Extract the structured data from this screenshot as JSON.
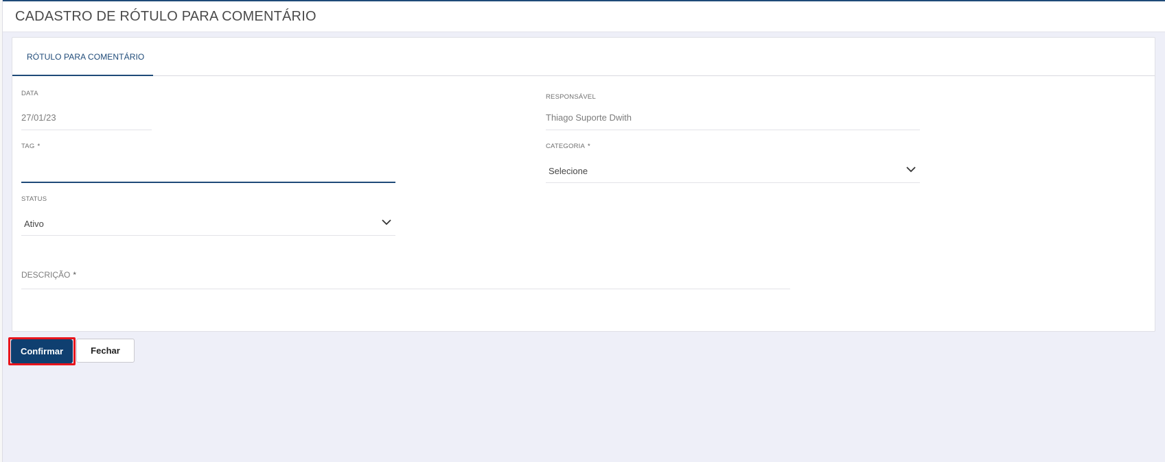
{
  "page": {
    "title": "CADASTRO DE RÓTULO PARA COMENTÁRIO"
  },
  "tabs": [
    {
      "label": "RÓTULO PARA COMENTÁRIO",
      "active": true
    }
  ],
  "form": {
    "data": {
      "label": "DATA",
      "value": "27/01/23"
    },
    "responsavel": {
      "label": "RESPONSÁVEL",
      "value": "Thiago Suporte Dwith"
    },
    "tag": {
      "label": "TAG",
      "required": "*",
      "value": ""
    },
    "categoria": {
      "label": "CATEGORIA",
      "required": "*",
      "selected": "Selecione"
    },
    "status": {
      "label": "STATUS",
      "selected": "Ativo"
    },
    "descricao": {
      "label": "DESCRIÇÃO",
      "required": "*",
      "value": ""
    }
  },
  "actions": {
    "confirm_label": "Confirmar",
    "close_label": "Fechar"
  },
  "colors": {
    "accent": "#1e4a78",
    "confirm_bg": "#0f3f70",
    "highlight": "#e8141c",
    "page_bg": "#eeeff8"
  },
  "icons": {
    "select_arrow": "chevron-down-icon"
  }
}
